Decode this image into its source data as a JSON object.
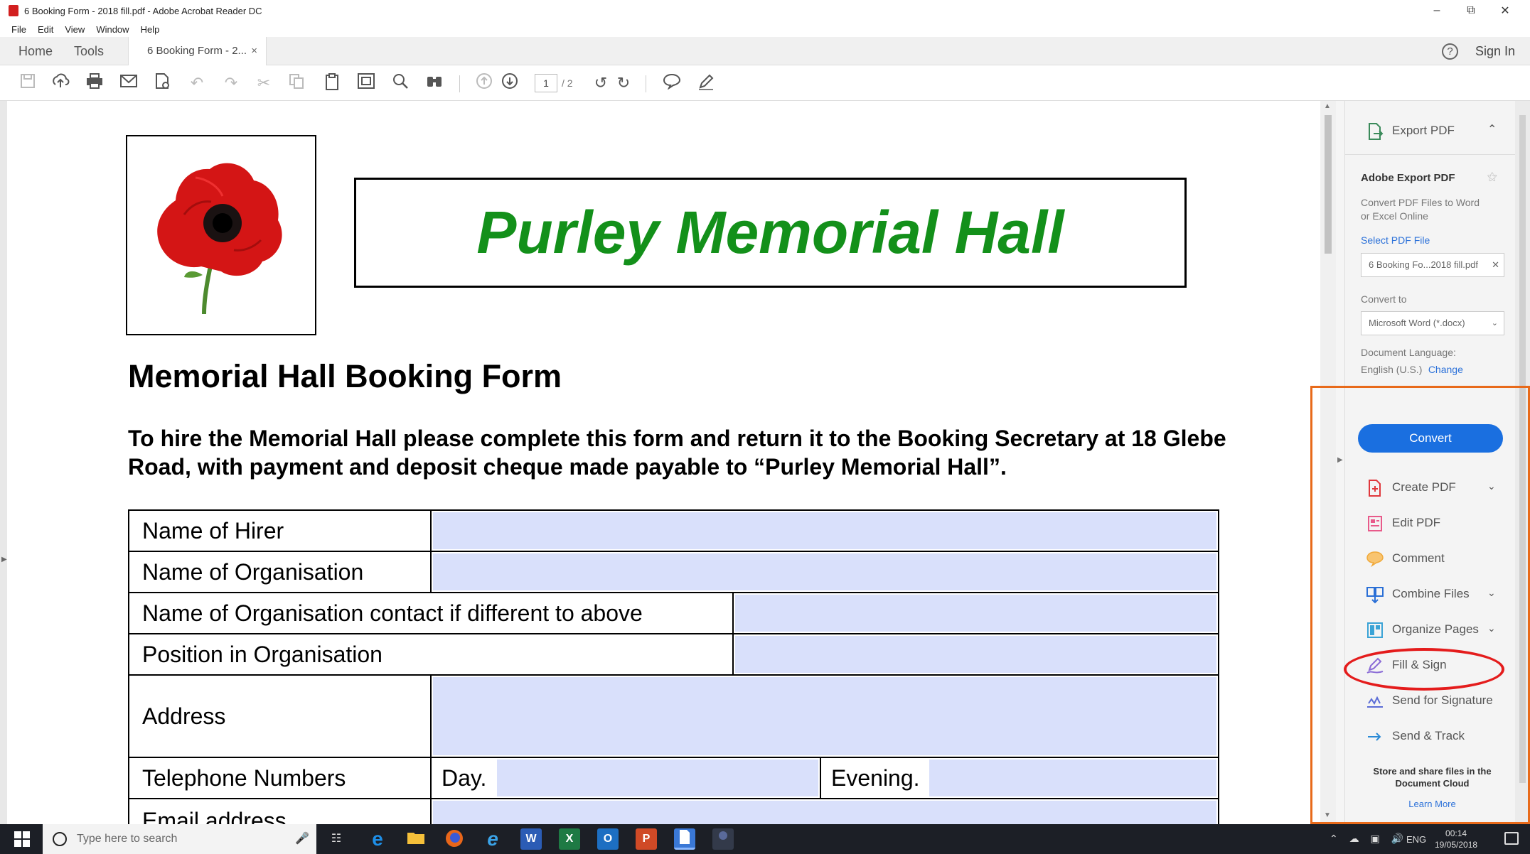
{
  "window": {
    "title": "6 Booking Form - 2018 fill.pdf - Adobe Acrobat Reader DC",
    "minimize": "–",
    "maximize": "⧉",
    "close": "✕"
  },
  "menu": [
    "File",
    "Edit",
    "View",
    "Window",
    "Help"
  ],
  "tabs": {
    "home": "Home",
    "tools": "Tools",
    "document": "6 Booking Form - 2...",
    "close": "×",
    "help": "?",
    "sign_in": "Sign In"
  },
  "toolbar": {
    "icons": [
      "save-icon",
      "upload-icon",
      "print-icon",
      "email-icon",
      "search-doc-icon",
      "undo-icon",
      "redo-icon",
      "cut-icon",
      "copy-icon",
      "paste-icon",
      "snapshot-icon",
      "find-icon",
      "binoculars-icon",
      "page-up-icon",
      "page-down-icon",
      "rotate-left-icon",
      "rotate-right-icon",
      "comment-icon",
      "pen-icon"
    ],
    "page_current": "1",
    "page_total": "/ 2"
  },
  "document": {
    "hall_title": "Purley Memorial Hall",
    "form_title": "Memorial Hall Booking Form",
    "intro": "To hire the Memorial Hall please complete this form and return it to the Booking Secretary at 18 Glebe Road, with payment and deposit cheque made payable to “Purley Memorial Hall”.",
    "rows": {
      "hirer": "Name of Hirer",
      "organisation": "Name of Organisation",
      "contact": "Name of Organisation contact if different to above",
      "position": "Position in Organisation",
      "address": "Address",
      "telephone": "Telephone Numbers",
      "day": "Day.",
      "evening": "Evening.",
      "email": "Email address"
    },
    "colors": {
      "hall_title": "#13901a",
      "field_fill": "#d9e0fb",
      "poppy": "#d41515"
    }
  },
  "right_pane": {
    "export_header": "Export PDF",
    "adobe_export": "Adobe Export PDF",
    "desc": "Convert PDF Files to Word or Excel Online",
    "select_pdf": "Select PDF File",
    "file_name": "6 Booking Fo...2018 fill.pdf",
    "file_close": "✕",
    "convert_to": "Convert to",
    "format": "Microsoft Word (*.docx)",
    "doc_lang_label": "Document Language:",
    "doc_lang_value": "English (U.S.)",
    "change": "Change",
    "convert_btn": "Convert",
    "tools": {
      "create": "Create PDF",
      "edit": "Edit PDF",
      "comment": "Comment",
      "combine": "Combine Files",
      "organize": "Organize Pages",
      "fill": "Fill & Sign",
      "send_sig": "Send for Signature",
      "send_track": "Send & Track"
    },
    "cloud_text": "Store and share files in the Document Cloud",
    "learn_more": "Learn More",
    "annotation_colors": {
      "box": "#e86a1a",
      "ellipse": "#e41c1c"
    }
  },
  "taskbar": {
    "search_placeholder": "Type here to search",
    "apps": [
      "task-view-icon",
      "edge-icon",
      "file-explorer-icon",
      "firefox-icon",
      "ie-icon",
      "word-icon",
      "excel-icon",
      "outlook-icon",
      "powerpoint-icon",
      "acrobat-doc-icon",
      "app-icon"
    ],
    "lang": "ENG",
    "time": "00:14",
    "date": "19/05/2018"
  }
}
